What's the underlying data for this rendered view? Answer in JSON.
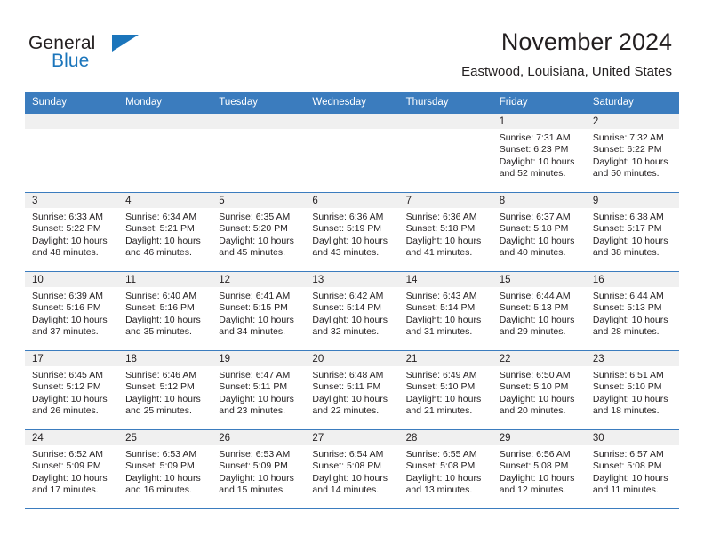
{
  "brand": {
    "line1": "General",
    "line2": "Blue",
    "triangle_icon": "blue-triangle-logo-mark",
    "accent_color": "#1b75bb"
  },
  "header": {
    "month_title": "November 2024",
    "location": "Eastwood, Louisiana, United States"
  },
  "theme": {
    "header_blue": "#3b7cbe",
    "day_strip_gray": "#f0f0f0",
    "text_color": "#231f20"
  },
  "calendar": {
    "weekdays": [
      "Sunday",
      "Monday",
      "Tuesday",
      "Wednesday",
      "Thursday",
      "Friday",
      "Saturday"
    ],
    "weeks": [
      [
        {
          "day": "",
          "empty": true,
          "sunrise": "",
          "sunset": "",
          "daylight_line1": "",
          "daylight_line2": ""
        },
        {
          "day": "",
          "empty": true,
          "sunrise": "",
          "sunset": "",
          "daylight_line1": "",
          "daylight_line2": ""
        },
        {
          "day": "",
          "empty": true,
          "sunrise": "",
          "sunset": "",
          "daylight_line1": "",
          "daylight_line2": ""
        },
        {
          "day": "",
          "empty": true,
          "sunrise": "",
          "sunset": "",
          "daylight_line1": "",
          "daylight_line2": ""
        },
        {
          "day": "",
          "empty": true,
          "sunrise": "",
          "sunset": "",
          "daylight_line1": "",
          "daylight_line2": ""
        },
        {
          "day": "1",
          "empty": false,
          "sunrise": "Sunrise: 7:31 AM",
          "sunset": "Sunset: 6:23 PM",
          "daylight_line1": "Daylight: 10 hours",
          "daylight_line2": "and 52 minutes."
        },
        {
          "day": "2",
          "empty": false,
          "sunrise": "Sunrise: 7:32 AM",
          "sunset": "Sunset: 6:22 PM",
          "daylight_line1": "Daylight: 10 hours",
          "daylight_line2": "and 50 minutes."
        }
      ],
      [
        {
          "day": "3",
          "empty": false,
          "sunrise": "Sunrise: 6:33 AM",
          "sunset": "Sunset: 5:22 PM",
          "daylight_line1": "Daylight: 10 hours",
          "daylight_line2": "and 48 minutes."
        },
        {
          "day": "4",
          "empty": false,
          "sunrise": "Sunrise: 6:34 AM",
          "sunset": "Sunset: 5:21 PM",
          "daylight_line1": "Daylight: 10 hours",
          "daylight_line2": "and 46 minutes."
        },
        {
          "day": "5",
          "empty": false,
          "sunrise": "Sunrise: 6:35 AM",
          "sunset": "Sunset: 5:20 PM",
          "daylight_line1": "Daylight: 10 hours",
          "daylight_line2": "and 45 minutes."
        },
        {
          "day": "6",
          "empty": false,
          "sunrise": "Sunrise: 6:36 AM",
          "sunset": "Sunset: 5:19 PM",
          "daylight_line1": "Daylight: 10 hours",
          "daylight_line2": "and 43 minutes."
        },
        {
          "day": "7",
          "empty": false,
          "sunrise": "Sunrise: 6:36 AM",
          "sunset": "Sunset: 5:18 PM",
          "daylight_line1": "Daylight: 10 hours",
          "daylight_line2": "and 41 minutes."
        },
        {
          "day": "8",
          "empty": false,
          "sunrise": "Sunrise: 6:37 AM",
          "sunset": "Sunset: 5:18 PM",
          "daylight_line1": "Daylight: 10 hours",
          "daylight_line2": "and 40 minutes."
        },
        {
          "day": "9",
          "empty": false,
          "sunrise": "Sunrise: 6:38 AM",
          "sunset": "Sunset: 5:17 PM",
          "daylight_line1": "Daylight: 10 hours",
          "daylight_line2": "and 38 minutes."
        }
      ],
      [
        {
          "day": "10",
          "empty": false,
          "sunrise": "Sunrise: 6:39 AM",
          "sunset": "Sunset: 5:16 PM",
          "daylight_line1": "Daylight: 10 hours",
          "daylight_line2": "and 37 minutes."
        },
        {
          "day": "11",
          "empty": false,
          "sunrise": "Sunrise: 6:40 AM",
          "sunset": "Sunset: 5:16 PM",
          "daylight_line1": "Daylight: 10 hours",
          "daylight_line2": "and 35 minutes."
        },
        {
          "day": "12",
          "empty": false,
          "sunrise": "Sunrise: 6:41 AM",
          "sunset": "Sunset: 5:15 PM",
          "daylight_line1": "Daylight: 10 hours",
          "daylight_line2": "and 34 minutes."
        },
        {
          "day": "13",
          "empty": false,
          "sunrise": "Sunrise: 6:42 AM",
          "sunset": "Sunset: 5:14 PM",
          "daylight_line1": "Daylight: 10 hours",
          "daylight_line2": "and 32 minutes."
        },
        {
          "day": "14",
          "empty": false,
          "sunrise": "Sunrise: 6:43 AM",
          "sunset": "Sunset: 5:14 PM",
          "daylight_line1": "Daylight: 10 hours",
          "daylight_line2": "and 31 minutes."
        },
        {
          "day": "15",
          "empty": false,
          "sunrise": "Sunrise: 6:44 AM",
          "sunset": "Sunset: 5:13 PM",
          "daylight_line1": "Daylight: 10 hours",
          "daylight_line2": "and 29 minutes."
        },
        {
          "day": "16",
          "empty": false,
          "sunrise": "Sunrise: 6:44 AM",
          "sunset": "Sunset: 5:13 PM",
          "daylight_line1": "Daylight: 10 hours",
          "daylight_line2": "and 28 minutes."
        }
      ],
      [
        {
          "day": "17",
          "empty": false,
          "sunrise": "Sunrise: 6:45 AM",
          "sunset": "Sunset: 5:12 PM",
          "daylight_line1": "Daylight: 10 hours",
          "daylight_line2": "and 26 minutes."
        },
        {
          "day": "18",
          "empty": false,
          "sunrise": "Sunrise: 6:46 AM",
          "sunset": "Sunset: 5:12 PM",
          "daylight_line1": "Daylight: 10 hours",
          "daylight_line2": "and 25 minutes."
        },
        {
          "day": "19",
          "empty": false,
          "sunrise": "Sunrise: 6:47 AM",
          "sunset": "Sunset: 5:11 PM",
          "daylight_line1": "Daylight: 10 hours",
          "daylight_line2": "and 23 minutes."
        },
        {
          "day": "20",
          "empty": false,
          "sunrise": "Sunrise: 6:48 AM",
          "sunset": "Sunset: 5:11 PM",
          "daylight_line1": "Daylight: 10 hours",
          "daylight_line2": "and 22 minutes."
        },
        {
          "day": "21",
          "empty": false,
          "sunrise": "Sunrise: 6:49 AM",
          "sunset": "Sunset: 5:10 PM",
          "daylight_line1": "Daylight: 10 hours",
          "daylight_line2": "and 21 minutes."
        },
        {
          "day": "22",
          "empty": false,
          "sunrise": "Sunrise: 6:50 AM",
          "sunset": "Sunset: 5:10 PM",
          "daylight_line1": "Daylight: 10 hours",
          "daylight_line2": "and 20 minutes."
        },
        {
          "day": "23",
          "empty": false,
          "sunrise": "Sunrise: 6:51 AM",
          "sunset": "Sunset: 5:10 PM",
          "daylight_line1": "Daylight: 10 hours",
          "daylight_line2": "and 18 minutes."
        }
      ],
      [
        {
          "day": "24",
          "empty": false,
          "sunrise": "Sunrise: 6:52 AM",
          "sunset": "Sunset: 5:09 PM",
          "daylight_line1": "Daylight: 10 hours",
          "daylight_line2": "and 17 minutes."
        },
        {
          "day": "25",
          "empty": false,
          "sunrise": "Sunrise: 6:53 AM",
          "sunset": "Sunset: 5:09 PM",
          "daylight_line1": "Daylight: 10 hours",
          "daylight_line2": "and 16 minutes."
        },
        {
          "day": "26",
          "empty": false,
          "sunrise": "Sunrise: 6:53 AM",
          "sunset": "Sunset: 5:09 PM",
          "daylight_line1": "Daylight: 10 hours",
          "daylight_line2": "and 15 minutes."
        },
        {
          "day": "27",
          "empty": false,
          "sunrise": "Sunrise: 6:54 AM",
          "sunset": "Sunset: 5:08 PM",
          "daylight_line1": "Daylight: 10 hours",
          "daylight_line2": "and 14 minutes."
        },
        {
          "day": "28",
          "empty": false,
          "sunrise": "Sunrise: 6:55 AM",
          "sunset": "Sunset: 5:08 PM",
          "daylight_line1": "Daylight: 10 hours",
          "daylight_line2": "and 13 minutes."
        },
        {
          "day": "29",
          "empty": false,
          "sunrise": "Sunrise: 6:56 AM",
          "sunset": "Sunset: 5:08 PM",
          "daylight_line1": "Daylight: 10 hours",
          "daylight_line2": "and 12 minutes."
        },
        {
          "day": "30",
          "empty": false,
          "sunrise": "Sunrise: 6:57 AM",
          "sunset": "Sunset: 5:08 PM",
          "daylight_line1": "Daylight: 10 hours",
          "daylight_line2": "and 11 minutes."
        }
      ]
    ]
  }
}
